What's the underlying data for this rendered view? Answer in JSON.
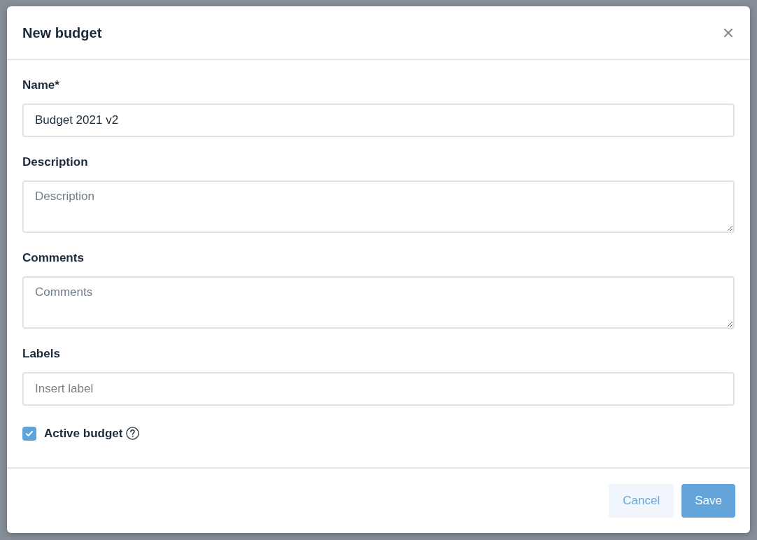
{
  "dialog": {
    "title": "New budget"
  },
  "fields": [
    {
      "kind": "text",
      "label": "Name*",
      "value": "Budget 2021 v2"
    },
    {
      "kind": "textarea",
      "label": "Description",
      "placeholder": "Description"
    },
    {
      "kind": "textarea",
      "label": "Comments",
      "placeholder": "Comments"
    },
    {
      "kind": "text",
      "label": "Labels",
      "placeholder": "Insert label"
    }
  ],
  "checkbox": {
    "label": "Active budget",
    "checked": true
  },
  "buttons": [
    {
      "kind": "secondary",
      "label": "Cancel"
    },
    {
      "kind": "primary",
      "label": "Save"
    }
  ]
}
